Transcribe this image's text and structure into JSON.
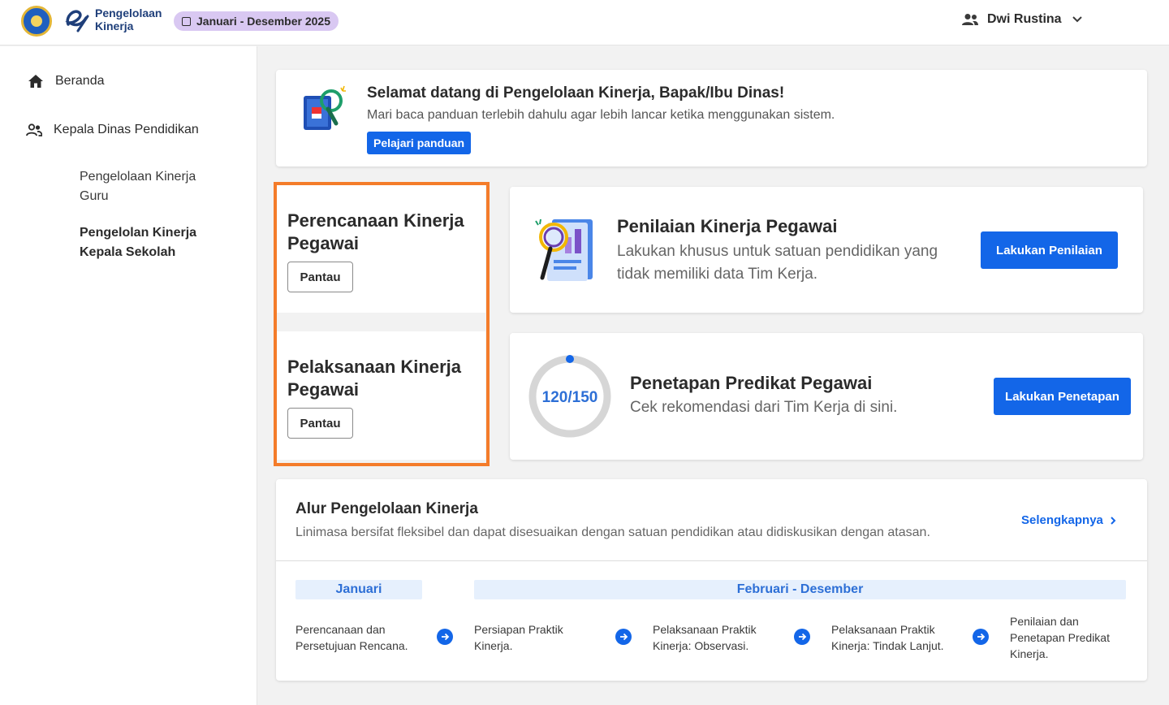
{
  "header": {
    "app_name_line1": "Pengelolaan",
    "app_name_line2": "Kinerja",
    "period": "Januari - Desember 2025",
    "user_name": "Dwi Rustina"
  },
  "sidebar": {
    "home": "Beranda",
    "role": "Kepala Dinas Pendidikan",
    "sub_items": [
      "Pengelolaan Kinerja Guru",
      "Pengelolan Kinerja Kepala Sekolah"
    ]
  },
  "welcome": {
    "title": "Selamat datang di Pengelolaan Kinerja, Bapak/Ibu Dinas!",
    "subtitle": "Mari baca panduan terlebih dahulu agar lebih lancar ketika menggunakan sistem.",
    "button": "Pelajari panduan"
  },
  "planning": {
    "title": "Perencanaan Kinerja Pegawai",
    "button": "Pantau"
  },
  "execution": {
    "title": "Pelaksanaan Kinerja Pegawai",
    "button": "Pantau"
  },
  "assessment": {
    "title": "Penilaian Kinerja Pegawai",
    "subtitle": "Lakukan khusus untuk satuan pendidikan yang tidak memiliki data Tim Kerja.",
    "button": "Lakukan Penilaian"
  },
  "predicate": {
    "progress_label": "120/150",
    "progress_done": 120,
    "progress_total": 150,
    "title": "Penetapan Predikat Pegawai",
    "subtitle": "Cek rekomendasi dari Tim Kerja di sini.",
    "button": "Lakukan Penetapan"
  },
  "alur": {
    "title": "Alur Pengelolaan Kinerja",
    "subtitle": "Linimasa bersifat fleksibel dan dapat disesuaikan dengan satuan pendidikan atau didiskusikan dengan atasan.",
    "more": "Selengkapnya",
    "phases": [
      "Januari",
      "Februari - Desember"
    ],
    "steps": [
      "Perencanaan dan Persetujuan Rencana.",
      "Persiapan Praktik Kinerja.",
      "Pelaksanaan Praktik Kinerja: Observasi.",
      "Pelaksanaan Praktik Kinerja: Tindak Lanjut.",
      "Penilaian dan Penetapan Predikat Kinerja."
    ]
  },
  "colors": {
    "primary": "#1366e8",
    "highlight": "#f47c2a",
    "chip": "#d9c8f2",
    "progress_track": "#d6d6d6"
  }
}
